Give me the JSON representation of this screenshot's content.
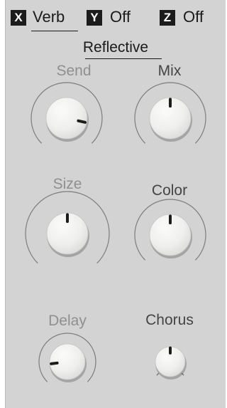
{
  "slots": [
    {
      "letter": "X",
      "value": "Verb",
      "active": true
    },
    {
      "letter": "Y",
      "value": "Off",
      "active": false
    },
    {
      "letter": "Z",
      "value": "Off",
      "active": false
    }
  ],
  "preset": "Reflective",
  "knobs": [
    {
      "id": "send",
      "label": "Send",
      "value": 0.88,
      "enabled": false
    },
    {
      "id": "mix",
      "label": "Mix",
      "value": 0.5,
      "enabled": true
    },
    {
      "id": "size",
      "label": "Size",
      "value": 0.5,
      "enabled": false
    },
    {
      "id": "color",
      "label": "Color",
      "value": 0.5,
      "enabled": true
    },
    {
      "id": "delay",
      "label": "Delay",
      "value": 0.14,
      "enabled": false
    },
    {
      "id": "chorus",
      "label": "Chorus",
      "value": 0.5,
      "enabled": true
    }
  ],
  "colors": {
    "panel": "#d3d3d3",
    "knob_face": "#f0f0ef",
    "indicator": "#1c1c1c",
    "ring": "#7c7c7c",
    "label_dim": "#8f8f8f",
    "label_dark": "#444444"
  }
}
